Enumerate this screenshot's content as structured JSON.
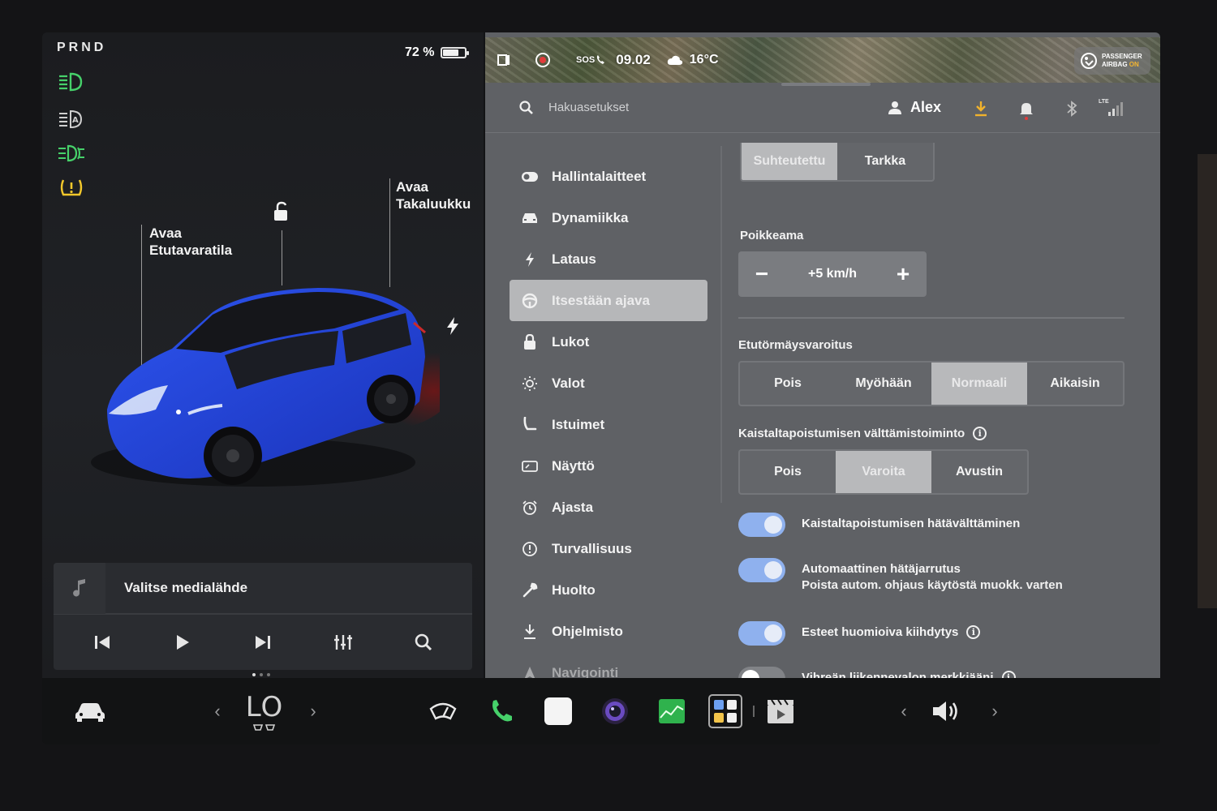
{
  "drive": {
    "gears": "PRND"
  },
  "battery": {
    "percent_label": "72 %",
    "level": 0.72
  },
  "car": {
    "frunk_label_1": "Avaa",
    "frunk_label_2": "Etutavaratila",
    "trunk_label_1": "Avaa",
    "trunk_label_2": "Takaluukku",
    "paint_color": "#1f3fd0"
  },
  "media": {
    "source_label": "Valitse medialähde"
  },
  "status": {
    "sos": "SOS",
    "time": "09.02",
    "temperature": "16°C",
    "airbag_line1": "PASSENGER",
    "airbag_line2": "AIRBAG",
    "airbag_state": "ON"
  },
  "topbar": {
    "search_placeholder": "Hakuasetukset",
    "user_name": "Alex",
    "lte_label": "LTE"
  },
  "nav": {
    "items": [
      {
        "label": "Hallintalaitteet",
        "icon": "toggle-icon"
      },
      {
        "label": "Dynamiikka",
        "icon": "car-front-icon"
      },
      {
        "label": "Lataus",
        "icon": "bolt-icon"
      },
      {
        "label": "Itsestään ajava",
        "icon": "steering-wheel-icon",
        "active": true
      },
      {
        "label": "Lukot",
        "icon": "lock-icon"
      },
      {
        "label": "Valot",
        "icon": "sun-icon"
      },
      {
        "label": "Istuimet",
        "icon": "seat-icon"
      },
      {
        "label": "Näyttö",
        "icon": "display-icon"
      },
      {
        "label": "Ajasta",
        "icon": "alarm-clock-icon"
      },
      {
        "label": "Turvallisuus",
        "icon": "alert-circle-icon"
      },
      {
        "label": "Huolto",
        "icon": "wrench-icon"
      },
      {
        "label": "Ohjelmisto",
        "icon": "download-icon"
      },
      {
        "label": "Navigointi",
        "icon": "navigation-arrow-icon"
      }
    ]
  },
  "settings": {
    "mode_options": [
      "Suhteutettu",
      "Tarkka"
    ],
    "mode_selected": "Suhteutettu",
    "offset_title": "Poikkeama",
    "offset_value": "+5 km/h",
    "fcw_title": "Etutörmäysvaroitus",
    "fcw_options": [
      "Pois",
      "Myöhään",
      "Normaali",
      "Aikaisin"
    ],
    "fcw_selected": "Normaali",
    "ldw_title": "Kaistaltapoistumisen välttämistoiminto",
    "ldw_options": [
      "Pois",
      "Varoita",
      "Avustin"
    ],
    "ldw_selected": "Varoita",
    "toggles": [
      {
        "label": "Kaistaltapoistumisen hätävälttäminen",
        "on": true
      },
      {
        "label": "Automaattinen hätäjarrutus",
        "sub": "Poista autom. ohjaus käytöstä muokk. varten",
        "on": true
      },
      {
        "label": "Esteet huomioiva kiihdytys",
        "on": true,
        "info": true
      },
      {
        "label": "Vihreän liikennevalon merkkiääni",
        "on": false,
        "info": true
      }
    ]
  },
  "dock": {
    "climate_label": "LO"
  },
  "colors": {
    "accent_green": "#46d16a",
    "warning_yellow": "#f3c82b",
    "toggle_blue": "#8fb1ee",
    "download_orange": "#f1b22c"
  }
}
